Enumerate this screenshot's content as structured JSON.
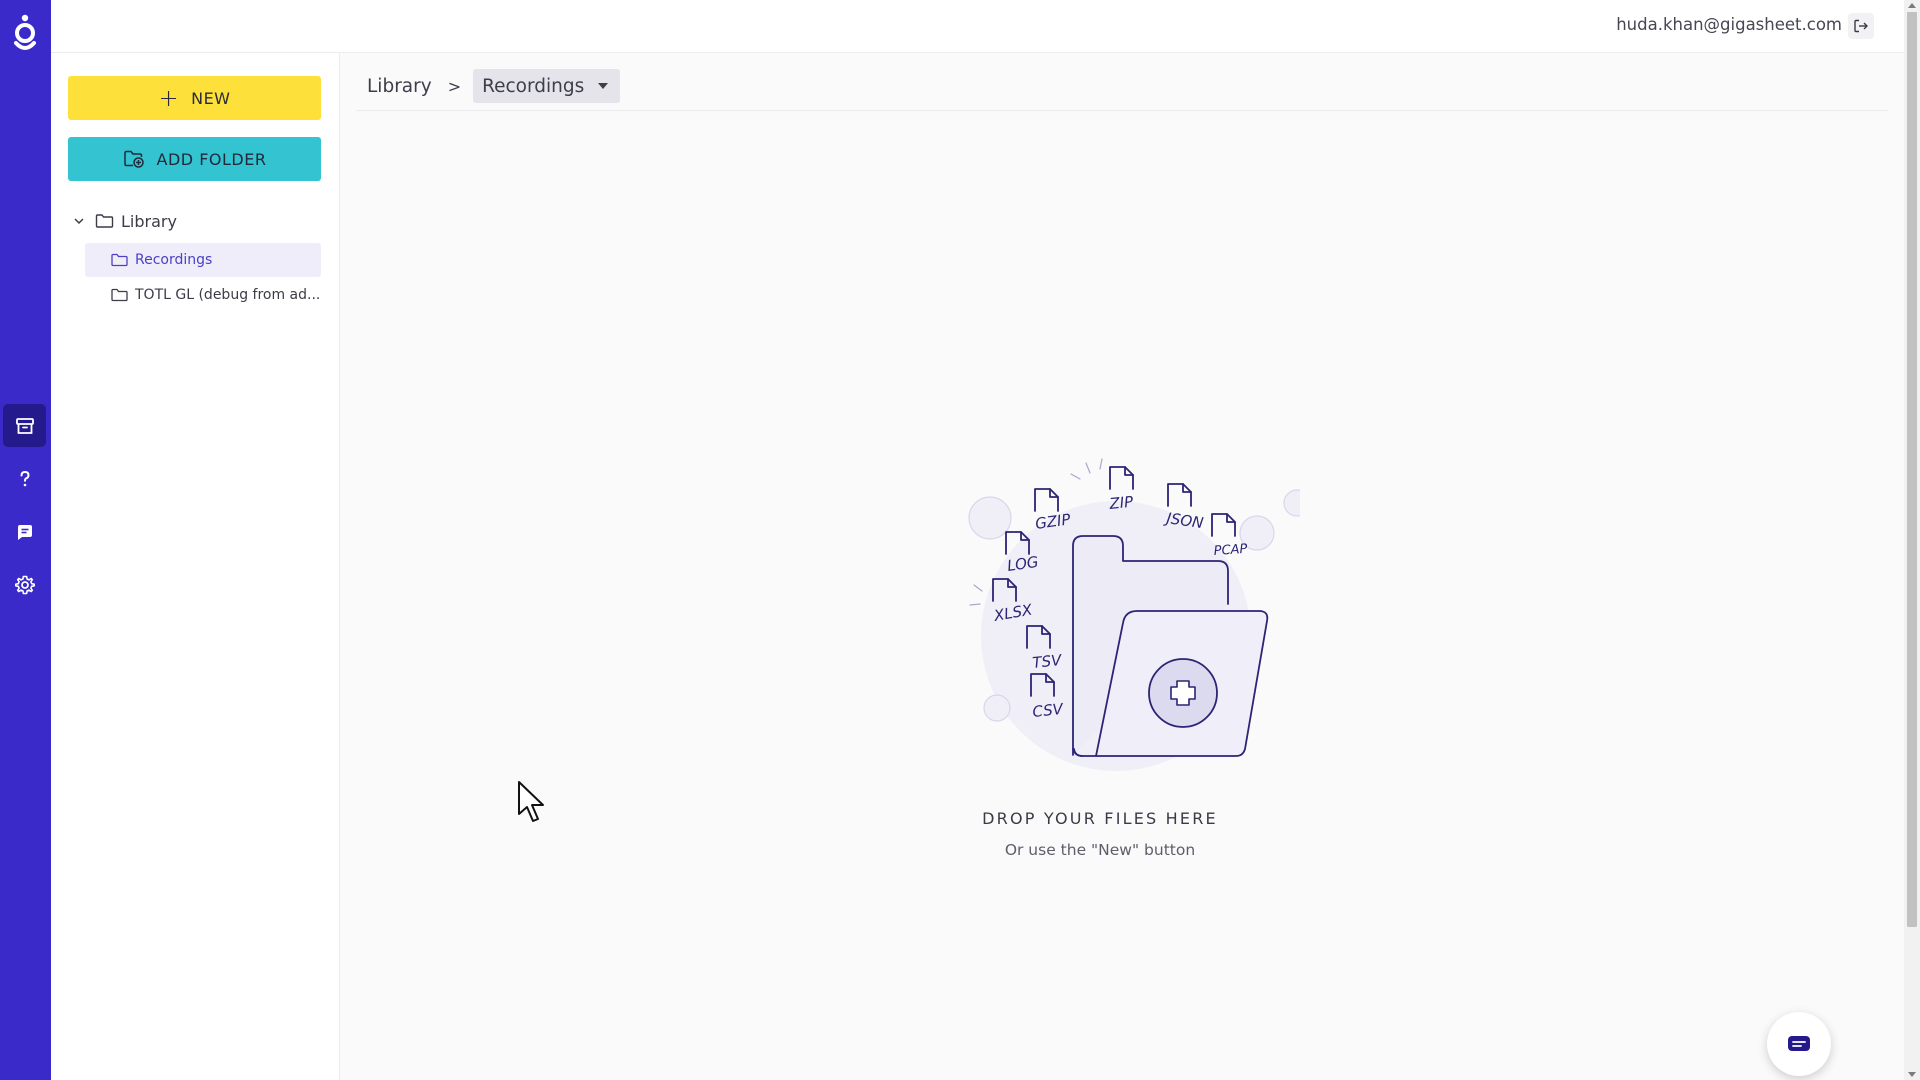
{
  "header": {
    "user_email": "huda.khan@gigasheet.com"
  },
  "rail": {
    "items": [
      {
        "name": "library",
        "icon": "archive-icon",
        "active": true
      },
      {
        "name": "help",
        "icon": "question-icon",
        "active": false
      },
      {
        "name": "chat",
        "icon": "chat-icon",
        "active": false
      },
      {
        "name": "settings",
        "icon": "gear-icon",
        "active": false
      }
    ]
  },
  "sidebar": {
    "new_label": "NEW",
    "add_folder_label": "ADD FOLDER",
    "tree": {
      "root_label": "Library",
      "items": [
        {
          "label": "Recordings",
          "selected": true
        },
        {
          "label": "TOTL GL (debug from ad..."
        }
      ]
    }
  },
  "breadcrumb": {
    "root": "Library",
    "separator": ">",
    "current": "Recordings"
  },
  "empty_state": {
    "title": "DROP YOUR FILES HERE",
    "subtitle": "Or use the \"New\" button",
    "file_types": [
      "GZIP",
      "ZIP",
      "JSON",
      "LOG",
      "PCAP",
      "XLSX",
      "TSV",
      "CSV"
    ]
  },
  "colors": {
    "rail": "#3a2ac9",
    "rail_active": "#241a8c",
    "new_button": "#fde13a",
    "add_folder_button": "#33c3d1",
    "selected_item_bg": "#eeedf9",
    "illustration_stroke": "#2c2475"
  }
}
